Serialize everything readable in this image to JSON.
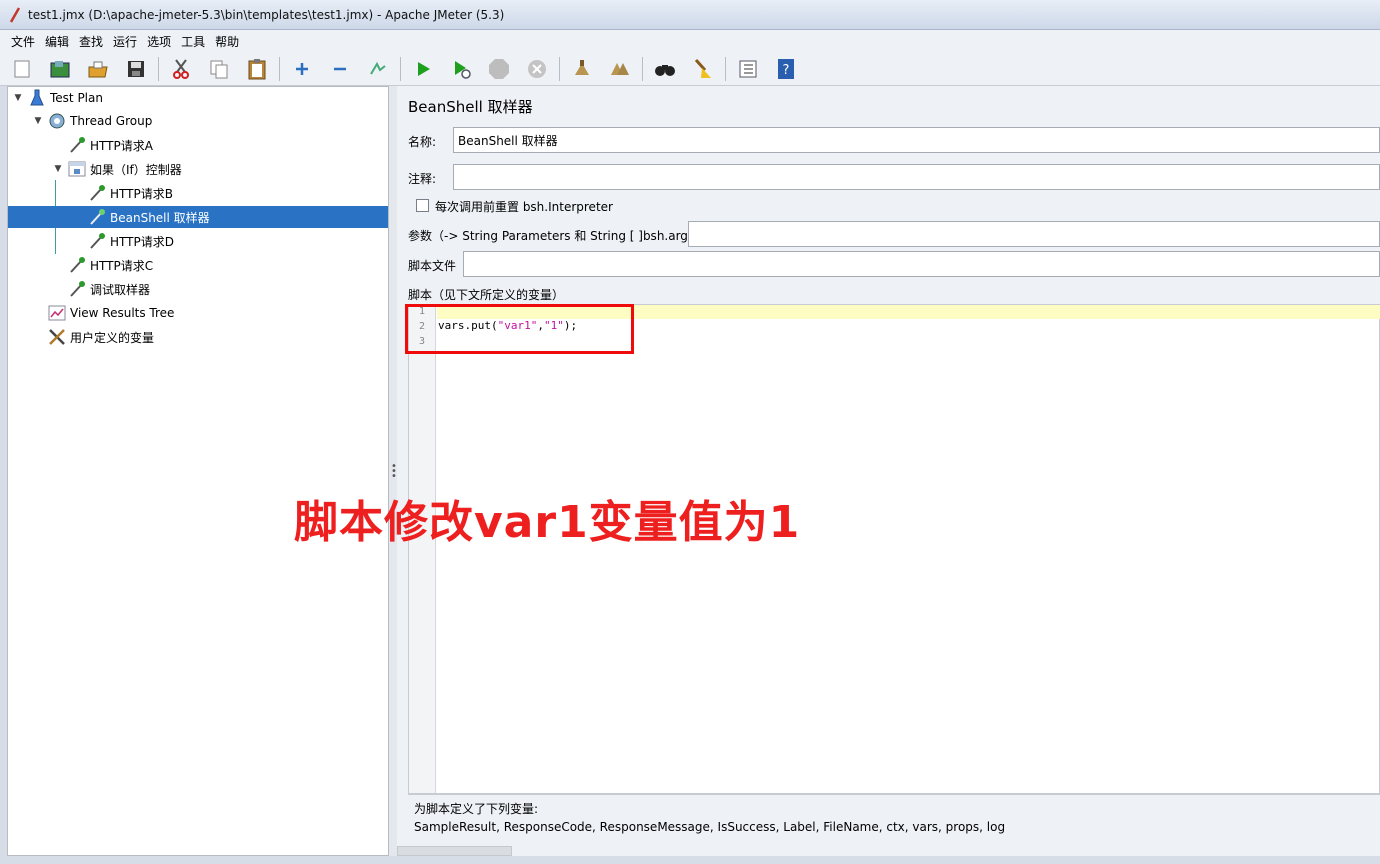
{
  "window": {
    "title": "test1.jmx (D:\\apache-jmeter-5.3\\bin\\templates\\test1.jmx) - Apache JMeter (5.3)"
  },
  "menu": [
    "文件",
    "编辑",
    "查找",
    "运行",
    "选项",
    "工具",
    "帮助"
  ],
  "toolbar": {
    "buttons": [
      "new-icon",
      "templates-icon",
      "open-icon",
      "save-icon",
      "cut-icon",
      "copy-icon",
      "paste-icon",
      "expand-icon",
      "collapse-icon",
      "toggle-icon",
      "start-icon",
      "start-no-pause-icon",
      "stop-icon",
      "shutdown-icon",
      "clear-icon",
      "clear-all-icon",
      "search-icon",
      "reset-search-icon",
      "function-helper-icon",
      "help-icon"
    ]
  },
  "tree": {
    "items": [
      {
        "label": "Test Plan",
        "icon": "test-plan-icon"
      },
      {
        "label": "Thread Group",
        "icon": "thread-group-icon"
      },
      {
        "label": "HTTP请求A",
        "icon": "sampler-icon"
      },
      {
        "label": "如果（If）控制器",
        "icon": "if-controller-icon"
      },
      {
        "label": "HTTP请求B",
        "icon": "sampler-icon"
      },
      {
        "label": "BeanShell 取样器",
        "icon": "sampler-icon"
      },
      {
        "label": "HTTP请求D",
        "icon": "sampler-icon"
      },
      {
        "label": "HTTP请求C",
        "icon": "sampler-icon"
      },
      {
        "label": "调试取样器",
        "icon": "sampler-icon"
      },
      {
        "label": "View Results Tree",
        "icon": "chart-icon"
      },
      {
        "label": "用户定义的变量",
        "icon": "tools-icon"
      }
    ]
  },
  "panel": {
    "title": "BeanShell 取样器",
    "name_label": "名称:",
    "name_value": "BeanShell 取样器",
    "comment_label": "注释:",
    "comment_value": "",
    "reset_label": "每次调用前重置 bsh.Interpreter",
    "reset_checked": false,
    "params_label": "参数（-> String Parameters 和 String [ ]bsh.args）",
    "params_value": "",
    "script_file_label": "脚本文件",
    "script_file_value": "",
    "script_label": "脚本（见下文所定义的变量）",
    "script_lines": [
      "1",
      "2",
      "3"
    ],
    "code": {
      "prefix": "vars.put(",
      "arg1": "\"var1\"",
      "comma": ",",
      "arg2": "\"1\"",
      "suffix": ");"
    },
    "info_title": "为脚本定义了下列变量:",
    "info_vars": "SampleResult, ResponseCode, ResponseMessage, IsSuccess, Label, FileName, ctx, vars, props, log"
  },
  "annotation": "脚本修改var1变量值为1"
}
